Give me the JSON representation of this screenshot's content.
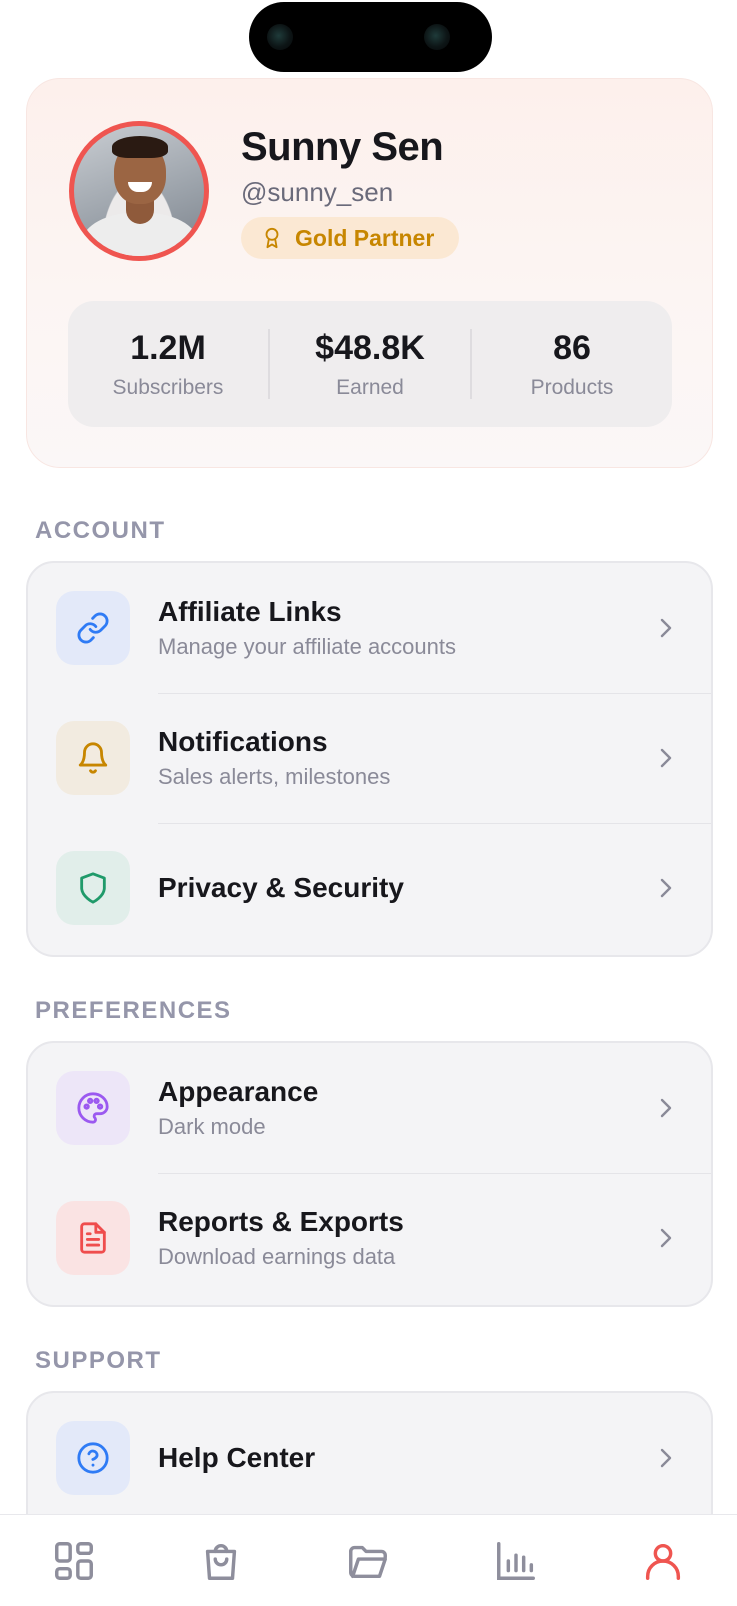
{
  "profile": {
    "name": "Sunny Sen",
    "handle": "@sunny_sen",
    "badge": "Gold Partner",
    "stats": [
      {
        "value": "1.2M",
        "label": "Subscribers"
      },
      {
        "value": "$48.8K",
        "label": "Earned"
      },
      {
        "value": "86",
        "label": "Products"
      }
    ]
  },
  "sections": {
    "account": {
      "label": "ACCOUNT",
      "items": [
        {
          "title": "Affiliate Links",
          "subtitle": "Manage your affiliate accounts",
          "icon": "link-icon"
        },
        {
          "title": "Notifications",
          "subtitle": "Sales alerts, milestones",
          "icon": "bell-icon"
        },
        {
          "title": "Privacy & Security",
          "icon": "shield-icon"
        }
      ]
    },
    "preferences": {
      "label": "PREFERENCES",
      "items": [
        {
          "title": "Appearance",
          "subtitle": "Dark mode",
          "icon": "palette-icon"
        },
        {
          "title": "Reports & Exports",
          "subtitle": "Download earnings data",
          "icon": "document-icon"
        }
      ]
    },
    "support": {
      "label": "SUPPORT",
      "items": [
        {
          "title": "Help Center",
          "icon": "help-icon"
        }
      ]
    }
  },
  "tabbar": {
    "tabs": [
      {
        "icon": "dashboard-icon",
        "active": false
      },
      {
        "icon": "shopping-bag-icon",
        "active": false
      },
      {
        "icon": "folder-icon",
        "active": false
      },
      {
        "icon": "bar-chart-icon",
        "active": false
      },
      {
        "icon": "profile-icon",
        "active": true
      }
    ]
  },
  "colors": {
    "accent": "#ef5550",
    "gold": "#c78600",
    "muted": "#8a8a98",
    "link_icon": "#2f7bf5",
    "bell_icon": "#c78600",
    "shield_icon": "#1f9a6a",
    "palette_icon": "#9b59f0",
    "document_icon": "#ef4d4d",
    "help_icon": "#2f7bf5"
  }
}
